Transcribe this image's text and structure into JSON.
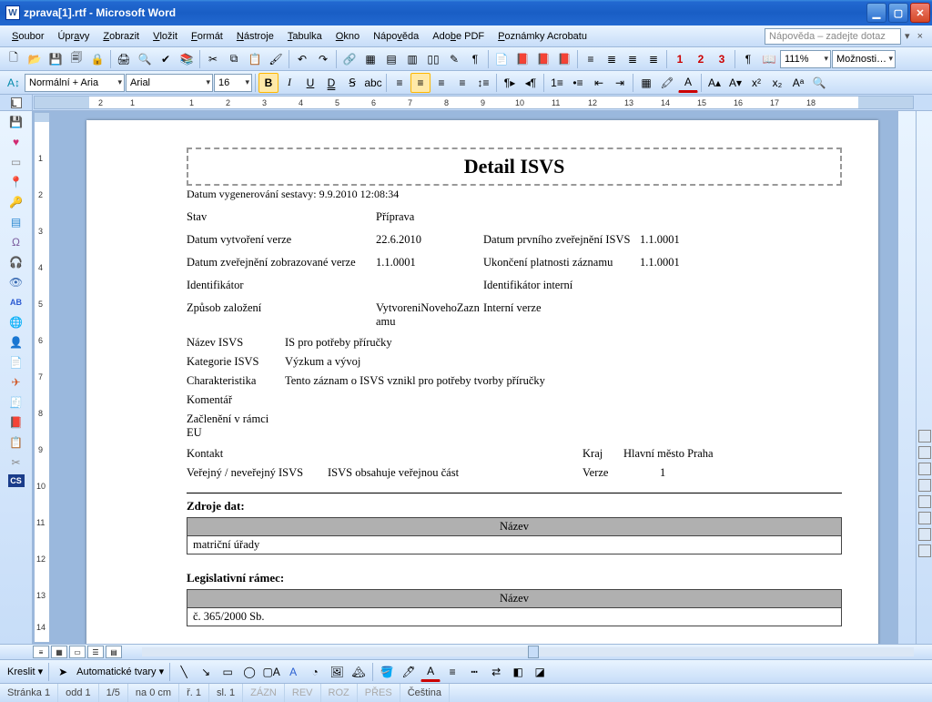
{
  "titlebar": {
    "title": "zprava[1].rtf - Microsoft Word"
  },
  "menu": {
    "items": [
      "Soubor",
      "Úpravy",
      "Zobrazit",
      "Vložit",
      "Formát",
      "Nástroje",
      "Tabulka",
      "Okno",
      "Nápověda",
      "Adobe PDF",
      "Poznámky Acrobatu"
    ],
    "help_placeholder": "Nápověda – zadejte dotaz"
  },
  "toolbar1": {
    "zoom": "111%",
    "options": "Možnosti…"
  },
  "toolbar2": {
    "style": "Normální + Aria",
    "font": "Arial",
    "size": "16",
    "bold": "B",
    "italic": "I",
    "underline": "U",
    "dunder": "D",
    "strike": "Ꞩ",
    "abc": "abc"
  },
  "doc": {
    "title": "Detail ISVS",
    "gen": "Datum vygenerování sestavy: 9.9.2010 12:08:34",
    "rows": {
      "stav_l": "Stav",
      "stav_v": "Příprava",
      "dvv_l": "Datum vytvoření verze",
      "dvv_v": "22.6.2010",
      "dpz_l": "Datum prvního zveřejnění ISVS",
      "dpz_v": "1.1.0001",
      "dzz_l": "Datum zveřejnění zobrazované verze",
      "dzz_v": "1.1.0001",
      "ukp_l": "Ukončení platnosti záznamu",
      "ukp_v": "1.1.0001",
      "id_l": "Identifikátor",
      "idi_l": "Identifikátor interní",
      "zp_l": "Způsob založení",
      "zp_v": "VytvoreniNovehoZaznamu",
      "iv_l": "Interní verze"
    },
    "kv": {
      "nazev_l": "Název ISVS",
      "nazev_v": "IS pro potřeby příručky",
      "kat_l": "Kategorie ISVS",
      "kat_v": "Výzkum a vývoj",
      "char_l": "Charakteristika",
      "char_v": "Tento záznam o ISVS vznikl pro potřeby tvorby příručky",
      "kom_l": "Komentář",
      "zac_l": "Začlenění v rámci EU",
      "kon_l": "Kontakt",
      "kraj_l": "Kraj",
      "kraj_v": "Hlavní město Praha",
      "ver_l": "Veřejný / neveřejný ISVS",
      "ver_v": "ISVS obsahuje veřejnou část",
      "verze_l": "Verze",
      "verze_v": "1"
    },
    "zdroje": {
      "title": "Zdroje dat:",
      "col": "Název",
      "row": "matriční úřady"
    },
    "leg": {
      "title": "Legislativní rámec:",
      "col": "Název",
      "row": "č. 365/2000 Sb."
    }
  },
  "draw": {
    "kreslit": "Kreslit",
    "auto": "Automatické tvary"
  },
  "status": {
    "page": "Stránka  1",
    "sec": "odd  1",
    "pages": "1/5",
    "at": "na  0 cm",
    "line": "ř.  1",
    "col": "sl.  1",
    "rec": "ZÁZN",
    "rev": "REV",
    "ext": "ROZ",
    "ovr": "PŘES",
    "lang": "Čeština"
  }
}
